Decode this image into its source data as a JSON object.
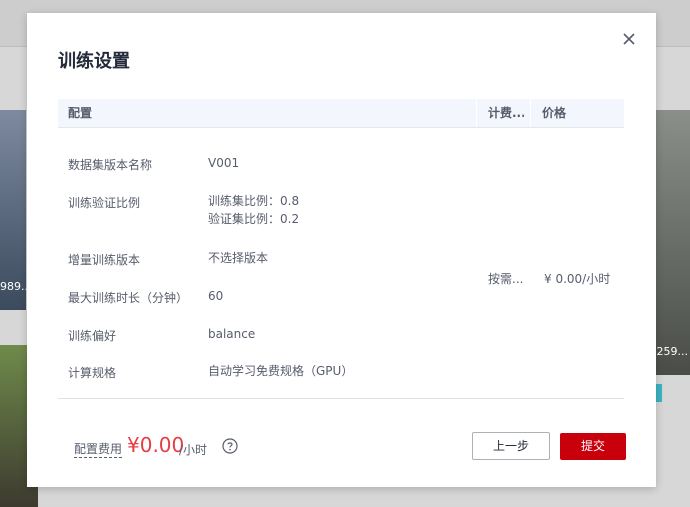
{
  "background": {
    "left_label": "989...",
    "right_label": "4259..."
  },
  "dialog": {
    "title": "训练设置",
    "table": {
      "headers": {
        "config": "配置",
        "billing": "计费...",
        "price": "价格"
      },
      "rows": [
        {
          "label": "数据集版本名称",
          "value": "V001"
        },
        {
          "label": "训练验证比例",
          "value_line1": "训练集比例：0.8",
          "value_line2": "验证集比例：0.2"
        },
        {
          "label": "增量训练版本",
          "value": "不选择版本"
        },
        {
          "label": "最大训练时长（分钟）",
          "value": "60"
        },
        {
          "label": "训练偏好",
          "value": "balance"
        },
        {
          "label": "计算规格",
          "value": "自动学习免费规格（GPU）"
        }
      ],
      "billing_mode": "按需...",
      "price": "¥ 0.00/小时"
    },
    "footer": {
      "fee_label": "配置费用",
      "fee_amount": "¥0.00",
      "fee_unit": "/小时",
      "prev_label": "上一步",
      "submit_label": "提交"
    }
  },
  "colors": {
    "accent": "#c7000b",
    "price": "#e53d44"
  }
}
